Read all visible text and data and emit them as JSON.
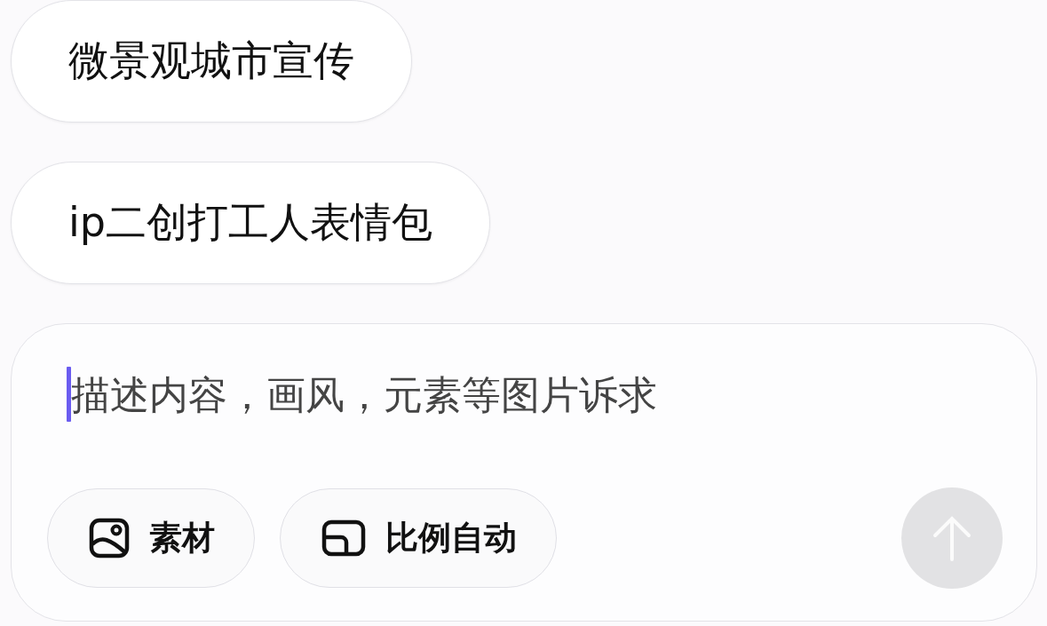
{
  "suggestions": [
    {
      "label": "微景观城市宣传"
    },
    {
      "label": "ip二创打工人表情包"
    }
  ],
  "composer": {
    "placeholder": "描述内容，画风，元素等图片诉求",
    "tools": [
      {
        "kind": "image",
        "label": "素材"
      },
      {
        "kind": "ratio",
        "label": "比例自动"
      }
    ],
    "send": {
      "disabled": true
    }
  }
}
